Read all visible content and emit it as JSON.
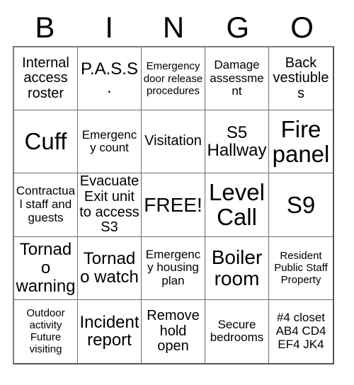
{
  "card": {
    "title": "BINGO",
    "header_letters": [
      "B",
      "I",
      "N",
      "G",
      "O"
    ],
    "columns": 5,
    "rows": 5,
    "free_space": "FREE!",
    "free_space_index": 12,
    "colors": {
      "background": "#ffffff",
      "text": "#000000",
      "grid_line": "#6e6e6e",
      "outer_border": "#555555"
    },
    "cells": [
      {
        "text": "Internal access roster",
        "size": "md"
      },
      {
        "text": "P.A.S.S.",
        "size": "lg"
      },
      {
        "text": "Emergency door release procedures",
        "size": "xs"
      },
      {
        "text": "Damage assessment",
        "size": "sm"
      },
      {
        "text": "Back vestiubles",
        "size": "md"
      },
      {
        "text": "Cuff",
        "size": "xxl"
      },
      {
        "text": "Emergency count",
        "size": "sm"
      },
      {
        "text": "Visitation",
        "size": "md"
      },
      {
        "text": "S5 Hallway",
        "size": "lg"
      },
      {
        "text": "Fire panel",
        "size": "xxl"
      },
      {
        "text": "Contractual staff and guests",
        "size": "sm"
      },
      {
        "text": "Evacuate Exit unit to access S3",
        "size": "md"
      },
      {
        "text": "FREE!",
        "size": "xl"
      },
      {
        "text": "Level Call",
        "size": "xxl"
      },
      {
        "text": "S9",
        "size": "xxl"
      },
      {
        "text": "Tornado warning",
        "size": "lg"
      },
      {
        "text": "Tornado watch",
        "size": "lg"
      },
      {
        "text": "Emergency housing plan",
        "size": "sm"
      },
      {
        "text": "Boiler room",
        "size": "xl"
      },
      {
        "text": "Resident Public Staff Property",
        "size": "xs"
      },
      {
        "text": "Outdoor activity Future visiting",
        "size": "xs"
      },
      {
        "text": "Incident report",
        "size": "lg"
      },
      {
        "text": "Remove hold open",
        "size": "md"
      },
      {
        "text": "Secure bedrooms",
        "size": "sm"
      },
      {
        "text": "#4 closet AB4 CD4 EF4 JK4",
        "size": "sm"
      }
    ]
  }
}
